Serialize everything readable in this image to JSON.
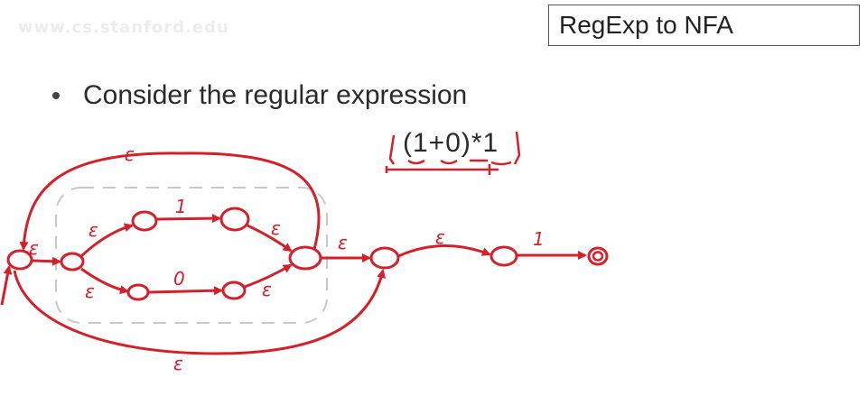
{
  "watermark": "www.cs.stanford.edu",
  "slide": {
    "title": "RegExp to NFA",
    "bullet": "Consider the regular expression",
    "regex": "(1+0)*1"
  },
  "annotations": {
    "epsilon": "ε",
    "one": "1",
    "zero": "0"
  },
  "colors": {
    "ink": "#d4202a",
    "text": "#2a2a2a",
    "dashed_box": "#c8c8c8"
  }
}
